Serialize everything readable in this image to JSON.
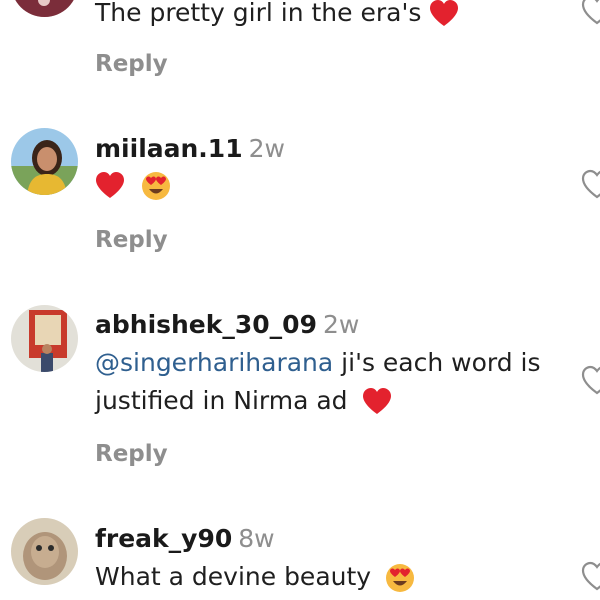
{
  "comments": [
    {
      "username": "",
      "time": "",
      "text": "The pretty girl in the era's",
      "reply_label": "Reply",
      "emojis": [
        "red-heart"
      ]
    },
    {
      "username": "miilaan.11",
      "time": "2w",
      "text": "",
      "reply_label": "Reply",
      "emojis": [
        "red-heart",
        "heart-eyes-face"
      ]
    },
    {
      "username": "abhishek_30_09",
      "time": "2w",
      "mention": "@singerhariharana",
      "text_line1": " ji's each word is",
      "text_line2": "justified in Nirma ad",
      "reply_label": "Reply",
      "emojis": [
        "red-heart"
      ]
    },
    {
      "username": "freak_y90",
      "time": "8w",
      "text": "What a devine beauty",
      "reply_label": "",
      "emojis": [
        "heart-eyes-face"
      ]
    }
  ],
  "icons": {
    "like": "heart-outline-icon",
    "heart_emoji_color": "#e3222e",
    "heart_eyes_face_color": "#f7b940"
  }
}
